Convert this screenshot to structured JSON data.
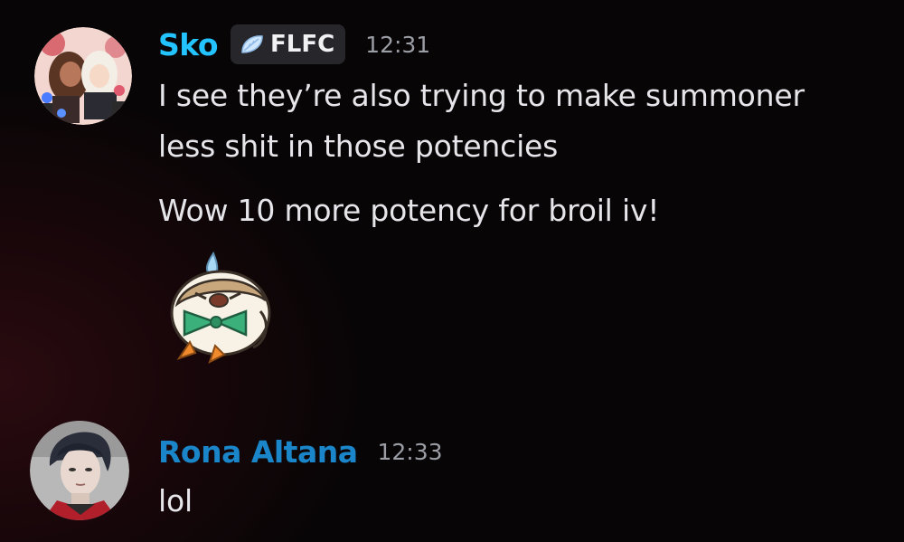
{
  "messages": [
    {
      "author": "Sko",
      "author_color": "#22c3ff",
      "tag": "FLFC",
      "time": "12:31",
      "lines": [
        "I see they’re also trying to make summoner",
        "less shit in those potencies",
        "Wow 10 more potency for broil iv!"
      ],
      "sticker": "rowlet-crying-sticker"
    },
    {
      "author": "Rona Altana",
      "author_color": "#1a86c9",
      "time": "12:33",
      "lines": [
        "lol"
      ]
    }
  ],
  "icons": {
    "tag_icon": "leaf-icon"
  }
}
